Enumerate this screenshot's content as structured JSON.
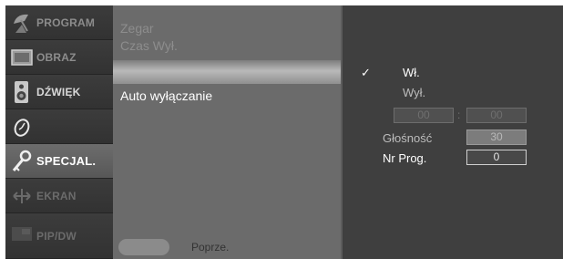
{
  "categories": [
    {
      "label": "PROGRAM",
      "icon": "satellite-dish-icon"
    },
    {
      "label": "OBRAZ",
      "icon": "picture-icon"
    },
    {
      "label": "DŹWIĘK",
      "icon": "speaker-icon"
    },
    {
      "label": "",
      "icon": "clock-icon"
    },
    {
      "label": "SPECJAL.",
      "icon": "key-icon"
    },
    {
      "label": "EKRAN",
      "icon": "screen-adjust-icon"
    },
    {
      "label": "PIP/DW",
      "icon": "pip-icon"
    }
  ],
  "active_category": "SPECJAL.",
  "menu": {
    "items": [
      "Zegar",
      "Czas Wył.",
      "Auto wyłączanie"
    ],
    "selected": "Auto wyłączanie",
    "prev_label": "Poprze."
  },
  "panel": {
    "on_label": "Wł.",
    "off_label": "Wył.",
    "checked": "Wł.",
    "check_mark": "✓",
    "time_hours": "00",
    "time_separator": ":",
    "time_minutes": "00",
    "volume_label": "Głośność",
    "volume_value": "30",
    "program_label": "Nr Prog.",
    "program_value": "0"
  }
}
